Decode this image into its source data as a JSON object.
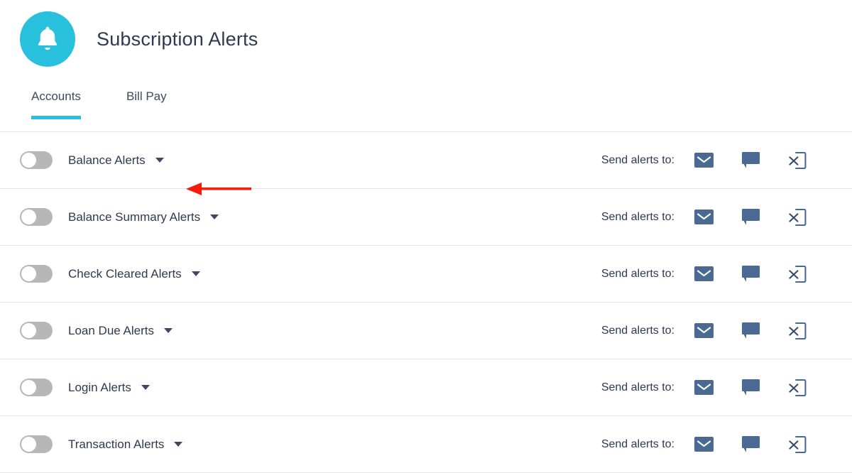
{
  "header": {
    "title": "Subscription Alerts",
    "icon": "bell-icon",
    "icon_bg_color": "#29c0de"
  },
  "tabs": {
    "active_index": 0,
    "items": [
      {
        "label": "Accounts",
        "active": true
      },
      {
        "label": "Bill Pay",
        "active": false
      }
    ],
    "active_underline_color": "#29c0de"
  },
  "annotation": {
    "type": "arrow",
    "direction": "left",
    "color": "#f81b0b",
    "points_to": "Bill Pay"
  },
  "rows": {
    "send_to_label": "Send alerts to:",
    "toggle_state": "off",
    "channel_icons": [
      {
        "name": "email-icon",
        "label": "Email",
        "state": "enabled"
      },
      {
        "name": "sms-message-icon",
        "label": "Text message",
        "state": "enabled"
      },
      {
        "name": "push-notification-off-icon",
        "label": "Push notification off",
        "state": "disabled"
      }
    ],
    "items": [
      {
        "label": "Balance Alerts",
        "toggle": "off",
        "send_to_label": "Send alerts to:"
      },
      {
        "label": "Balance Summary Alerts",
        "toggle": "off",
        "send_to_label": "Send alerts to:"
      },
      {
        "label": "Check Cleared Alerts",
        "toggle": "off",
        "send_to_label": "Send alerts to:"
      },
      {
        "label": "Loan Due Alerts",
        "toggle": "off",
        "send_to_label": "Send alerts to:"
      },
      {
        "label": "Login Alerts",
        "toggle": "off",
        "send_to_label": "Send alerts to:"
      },
      {
        "label": "Transaction Alerts",
        "toggle": "off",
        "send_to_label": "Send alerts to:"
      }
    ]
  },
  "colors": {
    "accent": "#29c0de",
    "text": "#2e3a4f",
    "icon_blue": "#4a6a94",
    "toggle_off": "#b7b7b7",
    "divider": "#e3e3e3",
    "annotation_red": "#f81b0b"
  }
}
